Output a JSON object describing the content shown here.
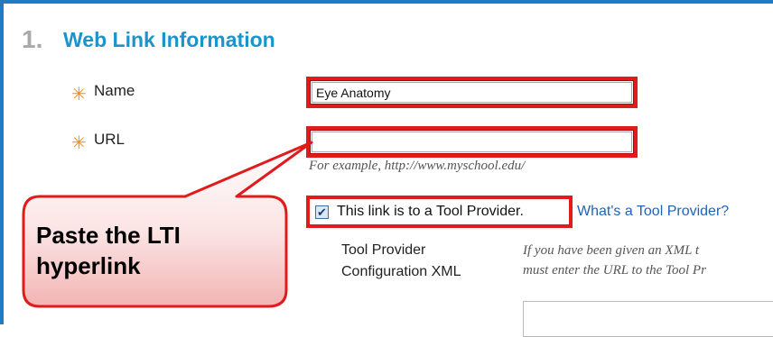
{
  "section": {
    "number": "1.",
    "title": "Web Link Information"
  },
  "fields": {
    "name": {
      "label": "Name",
      "value": "Eye Anatomy"
    },
    "url": {
      "label": "URL",
      "value": "",
      "example": "For example, http://www.myschool.edu/"
    }
  },
  "tool_provider": {
    "checkbox_label": "This link is to a Tool Provider.",
    "checked": true,
    "help_link": "What's a Tool Provider?",
    "config_label_line1": "Tool Provider",
    "config_label_line2": "Configuration XML",
    "config_help_line1": "If you have been given an XML t",
    "config_help_line2": "must enter the URL to the Tool Pr"
  },
  "callout": {
    "line1": "Paste the LTI",
    "line2": "hyperlink"
  },
  "colors": {
    "frame": "#1f7cc4",
    "title": "#1b95c9",
    "required_star": "#f08c2a",
    "highlight_red": "#e01b1b",
    "link": "#1f63b8"
  },
  "icons": {
    "required": "asterisk-icon",
    "checkbox": "checkmark-icon"
  }
}
